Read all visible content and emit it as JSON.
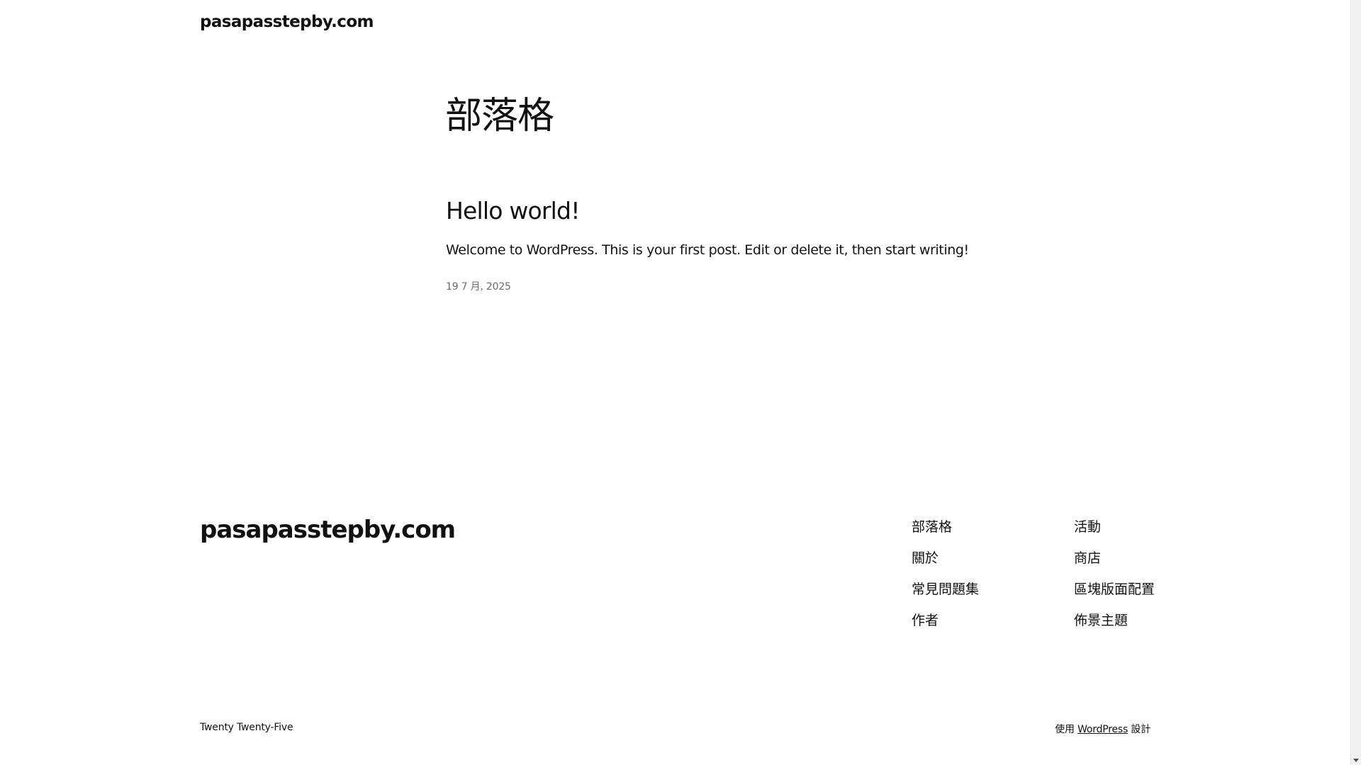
{
  "header": {
    "site_title": "pasapasstepby.com"
  },
  "main": {
    "page_title": "部落格",
    "post": {
      "title": "Hello world!",
      "excerpt": "Welcome to WordPress. This is your first post. Edit or delete it, then start writing!",
      "date": "19 7 月, 2025"
    }
  },
  "footer": {
    "site_title": "pasapasstepby.com",
    "nav_col1": [
      "部落格",
      "關於",
      "常見問題集",
      "作者"
    ],
    "nav_col2": [
      "活動",
      "商店",
      "區塊版面配置",
      "佈景主題"
    ],
    "theme_credit": "Twenty Twenty-Five",
    "credit_prefix": "使用",
    "credit_link": "WordPress",
    "credit_suffix": "設計"
  }
}
